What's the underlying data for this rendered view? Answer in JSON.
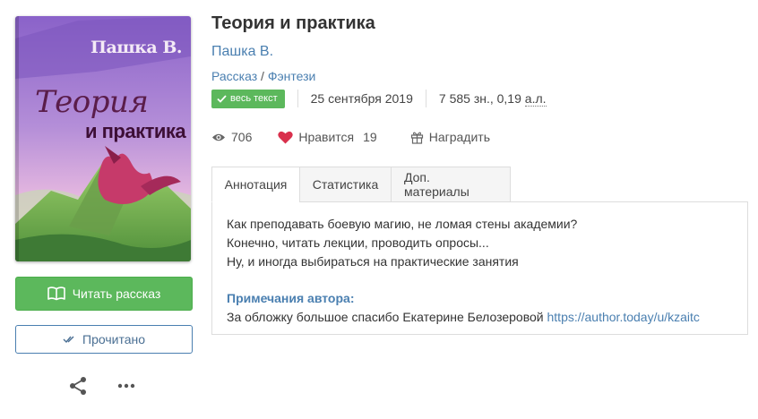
{
  "book": {
    "title": "Теория и практика",
    "author": "Пашка В.",
    "genres": [
      "Рассказ",
      "Фэнтези"
    ],
    "genre_separator": "/",
    "cover": {
      "author_text": "Пашка В.",
      "title_line_1": "Теория",
      "title_line_2": "и практика"
    }
  },
  "meta": {
    "status_badge": "весь текст",
    "date": "25 сентября 2019",
    "size_prefix": "7 585 зн., 0,19 ",
    "size_unit": "а.л."
  },
  "stats": {
    "views": "706",
    "likes_label": "Нравится",
    "likes_count": "19",
    "award_label": "Наградить"
  },
  "tabs": [
    {
      "label": "Аннотация",
      "active": true
    },
    {
      "label": "Статистика",
      "active": false
    },
    {
      "label": "Доп. материалы",
      "active": false
    }
  ],
  "annotation": {
    "lines": [
      "Как преподавать боевую магию, не ломая стены академии?",
      "Конечно, читать лекции, проводить опросы...",
      "Ну, и иногда выбираться на практические занятия"
    ],
    "notes_heading": "Примечания автора:",
    "notes_text": "За обложку большое спасибо Екатерине Белозеровой ",
    "notes_link": "https://author.today/u/kzaitc"
  },
  "actions": {
    "read_button": "Читать рассказ",
    "read_done_button": "Прочитано"
  },
  "icons": {
    "read": "book-open-icon",
    "read_done": "check-double-icon",
    "share": "share-icon",
    "more": "more-dots-icon",
    "views": "eye-icon",
    "likes": "heart-icon",
    "award": "gift-icon",
    "badge": "check-icon"
  },
  "colors": {
    "accent_green": "#5cb85c",
    "link_blue": "#4a7fb0",
    "heart_red": "#d9304c"
  }
}
